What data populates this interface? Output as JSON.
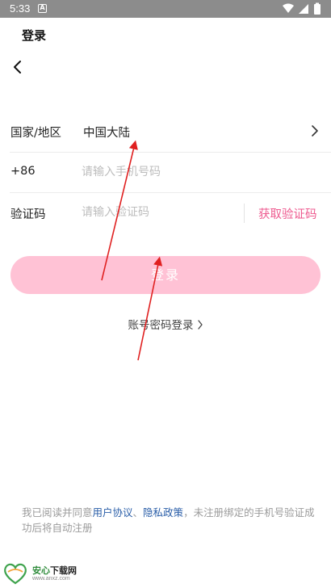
{
  "status_bar": {
    "time": "5:33",
    "notification_icon": "A"
  },
  "header": {
    "title": "登录"
  },
  "form": {
    "region": {
      "label": "国家/地区",
      "value": "中国大陆"
    },
    "phone": {
      "prefix": "+86",
      "placeholder": "请输入手机号码"
    },
    "code": {
      "label": "验证码",
      "placeholder": "请输入验证码",
      "get_code_label": "获取验证码"
    }
  },
  "login_button": {
    "label": "登录"
  },
  "password_login": {
    "label": "账号密码登录"
  },
  "agreement": {
    "prefix": "我已阅读并同意",
    "user_agreement": "用户协议",
    "sep": "、",
    "privacy_policy": "隐私政策",
    "suffix": "，未注册绑定的手机号验证成功后将自动注册"
  },
  "watermark": {
    "title_green": "安心",
    "title_dark": "下载网",
    "url": "www.anxz.com"
  },
  "colors": {
    "accent": "#ee5a8f",
    "button_disabled": "#ffc2d5",
    "link": "#2a5ea8",
    "status_bar": "#8c8c8c",
    "arrow": "#e02020"
  }
}
